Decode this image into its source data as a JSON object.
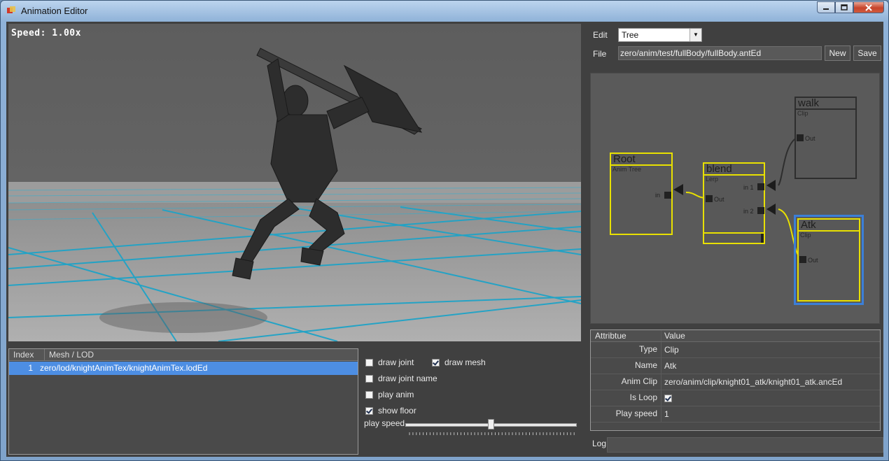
{
  "window": {
    "title": "Animation Editor"
  },
  "viewport": {
    "speed_text": "Speed: 1.00x"
  },
  "mesh_table": {
    "columns": [
      "Index",
      "Mesh / LOD"
    ],
    "rows": [
      {
        "index": "1",
        "path": "zero/lod/knightAnimTex/knightAnimTex.lodEd"
      }
    ]
  },
  "options": {
    "draw_joint": {
      "label": "draw joint",
      "checked": false
    },
    "draw_mesh": {
      "label": "draw mesh",
      "checked": true
    },
    "draw_joint_name": {
      "label": "draw joint name",
      "checked": false
    },
    "play_anim": {
      "label": "play anim",
      "checked": false
    },
    "show_floor": {
      "label": "show floor",
      "checked": true
    },
    "play_speed_label": "play speed",
    "play_speed_level": 0.5
  },
  "editor": {
    "edit_label": "Edit",
    "edit_value": "Tree",
    "file_label": "File",
    "file_value": "zero/anim/test/fullBody/fullBody.antEd",
    "new_button": "New",
    "save_button": "Save"
  },
  "graph": {
    "nodes": {
      "root": {
        "title": "Root",
        "type": "Anim Tree",
        "port_in": "in"
      },
      "blend": {
        "title": "blend",
        "type": "Lerp",
        "port_out": "Out",
        "port_in1": "in 1",
        "port_in2": "in 2"
      },
      "walk": {
        "title": "walk",
        "type": "Clip",
        "port_out": "Out"
      },
      "atk": {
        "title": "Atk",
        "type": "Clip",
        "port_out": "Out"
      }
    }
  },
  "properties": {
    "header": {
      "attr": "Attribtue",
      "value": "Value"
    },
    "rows": [
      {
        "key": "Type",
        "value": "Clip"
      },
      {
        "key": "Name",
        "value": "Atk"
      },
      {
        "key": "Anim Clip",
        "value": "zero/anim/clip/knight01_atk/knight01_atk.ancEd"
      },
      {
        "key": "Is Loop",
        "value": "",
        "checked": true
      },
      {
        "key": "Play speed",
        "value": "1"
      }
    ]
  },
  "log": {
    "label": "Log",
    "value": ""
  }
}
